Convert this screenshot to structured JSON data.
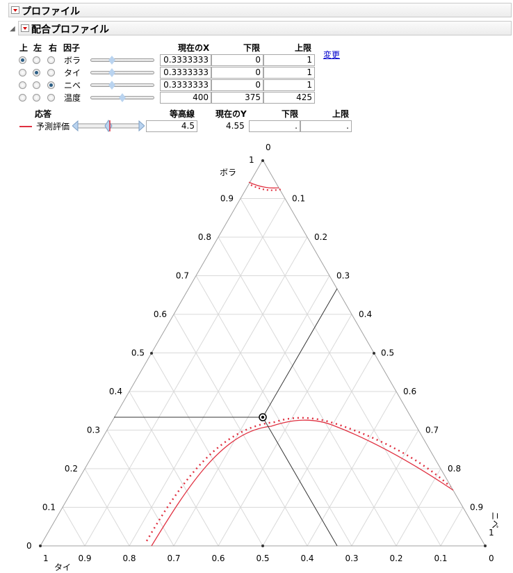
{
  "outline": {
    "profiler_title": "プロファイル",
    "mixture_title": "配合プロファイル"
  },
  "factors": {
    "col_top": "上",
    "col_left": "左",
    "col_right": "右",
    "col_factor": "因子",
    "col_current_x": "現在のX",
    "col_lower": "下限",
    "col_upper": "上限",
    "change_link": "変更",
    "rows": [
      {
        "name": "ボラ",
        "current": "0.3333333",
        "lower": "0",
        "upper": "1",
        "radio": "top",
        "slider_fraction": 0.333
      },
      {
        "name": "タイ",
        "current": "0.3333333",
        "lower": "0",
        "upper": "1",
        "radio": "left",
        "slider_fraction": 0.333
      },
      {
        "name": "ニベ",
        "current": "0.3333333",
        "lower": "0",
        "upper": "1",
        "radio": "right",
        "slider_fraction": 0.333
      },
      {
        "name": "温度",
        "current": "400",
        "lower": "375",
        "upper": "425",
        "radio": "none",
        "slider_fraction": 0.5
      }
    ]
  },
  "response": {
    "col_response": "応答",
    "col_contour": "等高線",
    "col_current_y": "現在のY",
    "col_lower": "下限",
    "col_upper": "上限",
    "name": "予測評価",
    "contour": "4.5",
    "current_y": "4.55",
    "lower": ".",
    "upper": ".",
    "line_color": "#e03040"
  },
  "plot": {
    "top_axis_label": "ボラ",
    "left_axis_label": "タイ",
    "right_axis_label": "ニベ",
    "vertex_top_label": "1",
    "vertex_left_label": "0",
    "vertex_right_label": "0",
    "apex_zero": "0",
    "apex_one": "1",
    "right_one": "1",
    "left_one": "1",
    "ticks": [
      "0.1",
      "0.2",
      "0.3",
      "0.4",
      "0.5",
      "0.6",
      "0.7",
      "0.8",
      "0.9"
    ],
    "current_point": {
      "ボラ": 0.3333333,
      "タイ": 0.3333333,
      "ニベ": 0.3333333
    },
    "contour_color": "#e03040",
    "grid_color": "#d9d9d9"
  }
}
